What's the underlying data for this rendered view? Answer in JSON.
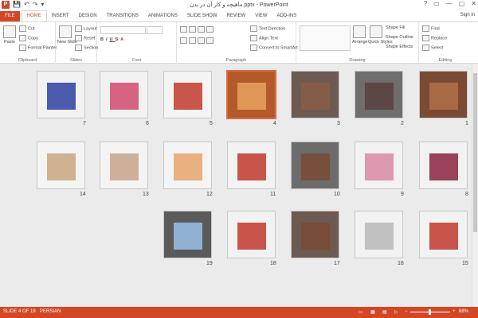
{
  "app": {
    "logo_letter": "P",
    "title": "ماهیچه و کار آن در بدن.pptx - PowerPoint",
    "window_controls": [
      "?",
      "▭",
      "—",
      "▢",
      "✕"
    ],
    "quick_access": [
      "💾",
      "↶",
      "↷",
      "▾"
    ]
  },
  "tabs": [
    {
      "label": "FILE",
      "key": "file"
    },
    {
      "label": "HOME",
      "key": "home"
    },
    {
      "label": "INSERT",
      "key": "insert"
    },
    {
      "label": "DESIGN",
      "key": "design"
    },
    {
      "label": "TRANSITIONS",
      "key": "transitions"
    },
    {
      "label": "ANIMATIONS",
      "key": "animations"
    },
    {
      "label": "SLIDE SHOW",
      "key": "slideshow"
    },
    {
      "label": "REVIEW",
      "key": "review"
    },
    {
      "label": "VIEW",
      "key": "view"
    },
    {
      "label": "ADD-INS",
      "key": "addins"
    }
  ],
  "signin": "Sign in",
  "ribbon": {
    "clipboard": {
      "label": "Clipboard",
      "paste": "Paste",
      "cut": "Cut",
      "copy": "Copy",
      "format_painter": "Format Painter"
    },
    "slides": {
      "label": "Slides",
      "new_slide": "New Slide",
      "layout": "Layout",
      "reset": "Reset",
      "section": "Section"
    },
    "font": {
      "label": "Font"
    },
    "paragraph": {
      "label": "Paragraph",
      "text_direction": "Text Direction",
      "align_text": "Align Text",
      "convert_smartart": "Convert to SmartArt"
    },
    "drawing": {
      "label": "Drawing",
      "arrange": "Arrange",
      "quick_styles": "Quick Styles",
      "shape_fill": "Shape Fill",
      "shape_outline": "Shape Outline",
      "shape_effects": "Shape Effects"
    },
    "editing": {
      "label": "Editing",
      "find": "Find",
      "replace": "Replace",
      "select": "Select"
    }
  },
  "slides": [
    {
      "num": "1",
      "bg": "#7a4a32",
      "accent": "#b0704a"
    },
    {
      "num": "2",
      "bg": "#6e6e6e",
      "accent": "#5a4040"
    },
    {
      "num": "3",
      "bg": "#6c5a52",
      "accent": "#8a5d46"
    },
    {
      "num": "4",
      "bg": "#b45a2a",
      "accent": "#e7a15e",
      "selected": true
    },
    {
      "num": "5",
      "bg": "#f4f4f4",
      "accent": "#c0392b"
    },
    {
      "num": "6",
      "bg": "#f2f2f2",
      "accent": "#d14a6e"
    },
    {
      "num": "7",
      "bg": "#f2f2f2",
      "accent": "#2e3f9f"
    },
    {
      "num": "8",
      "bg": "#f2f2f2",
      "accent": "#8a2340"
    },
    {
      "num": "9",
      "bg": "#f2f2f2",
      "accent": "#d98aa5"
    },
    {
      "num": "10",
      "bg": "#6c6c6c",
      "accent": "#7a4a32"
    },
    {
      "num": "11",
      "bg": "#f2f2f2",
      "accent": "#c0392b"
    },
    {
      "num": "12",
      "bg": "#f4f4f4",
      "accent": "#e6a36b"
    },
    {
      "num": "13",
      "bg": "#f4f4f4",
      "accent": "#c7a38a"
    },
    {
      "num": "14",
      "bg": "#f4f4f4",
      "accent": "#c9a67e"
    },
    {
      "num": "15",
      "bg": "#f2f2f2",
      "accent": "#c0392b"
    },
    {
      "num": "16",
      "bg": "#f2f2f2",
      "accent": "#b8b8b8"
    },
    {
      "num": "17",
      "bg": "#6c5a52",
      "accent": "#7a4a32"
    },
    {
      "num": "18",
      "bg": "#f2f2f2",
      "accent": "#c0392b"
    },
    {
      "num": "19",
      "bg": "#5a5a5a",
      "accent": "#9ac0e8"
    }
  ],
  "status": {
    "slide_of": "SLIDE 4 OF 19",
    "language": "PERSIAN",
    "zoom": "68%"
  }
}
